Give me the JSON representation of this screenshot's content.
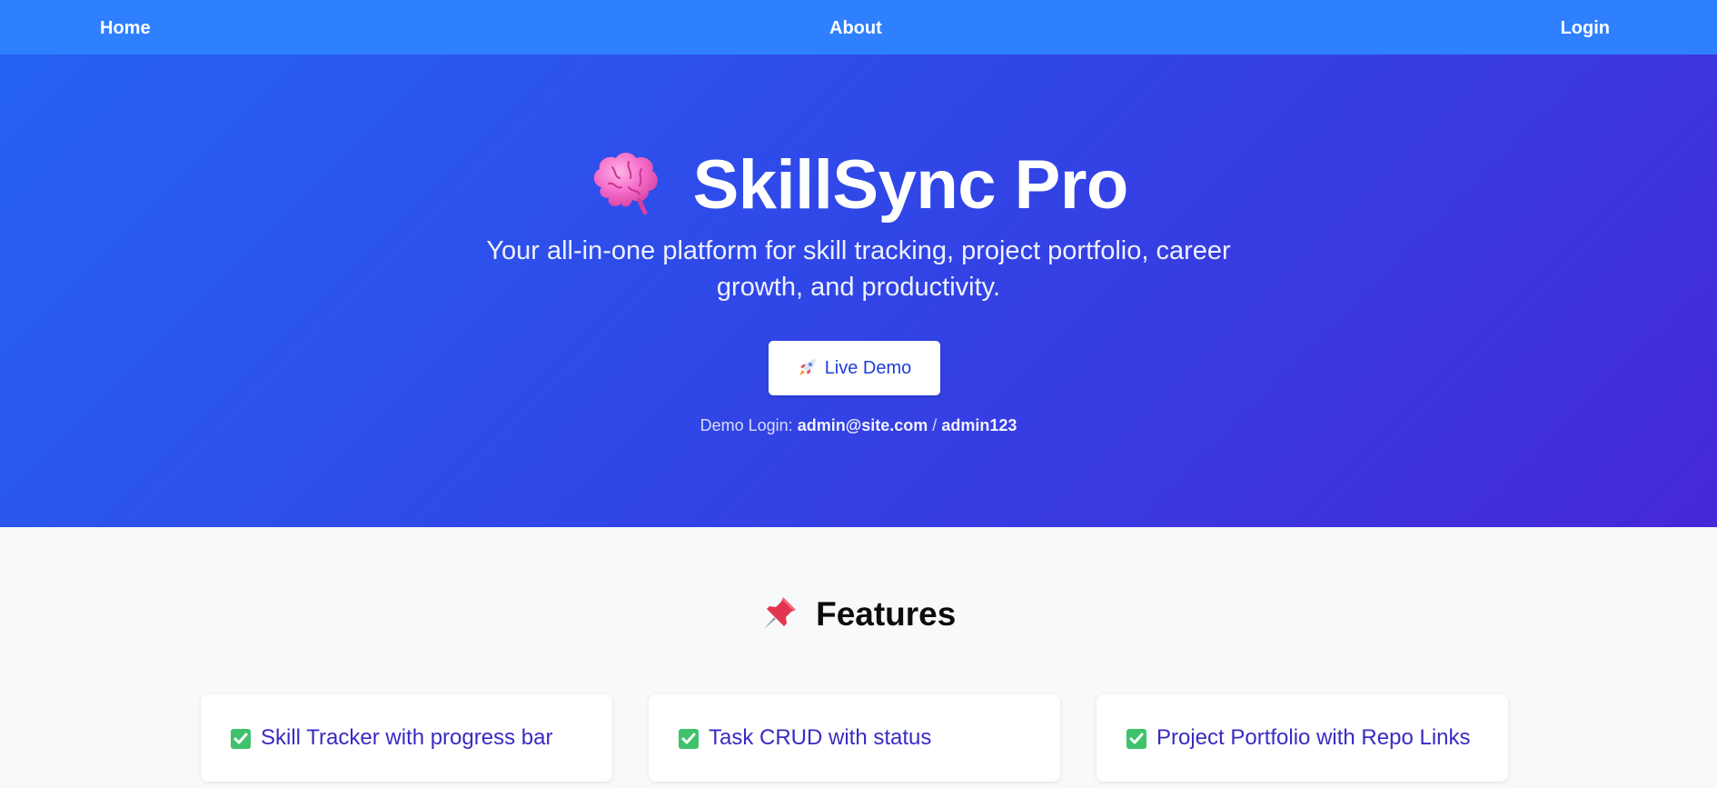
{
  "nav": {
    "home": "Home",
    "about": "About",
    "login": "Login"
  },
  "hero": {
    "icon": "brain-icon",
    "title": "SkillSync Pro",
    "subtitle": "Your all-in-one platform for skill tracking, project portfolio, career growth, and productivity.",
    "demo_button": {
      "icon": "rocket-icon",
      "label": "Live Demo"
    },
    "demo_login": {
      "prefix": "Demo Login:",
      "email": "admin@site.com",
      "separator": "/",
      "password": "admin123"
    }
  },
  "features": {
    "icon": "pushpin-icon",
    "title": "Features",
    "items": [
      {
        "icon": "check-icon",
        "label": "Skill Tracker with progress bar"
      },
      {
        "icon": "check-icon",
        "label": "Task CRUD with status"
      },
      {
        "icon": "check-icon",
        "label": "Project Portfolio with Repo Links"
      }
    ]
  },
  "colors": {
    "nav_bg": "#2f80ff",
    "hero_gradient_start": "#2563f3",
    "hero_gradient_end": "#4528d8",
    "button_text": "#1d3fd8",
    "feature_text": "#3a2bc2",
    "check_green": "#3fc26b",
    "page_bg": "#f8f9fb"
  }
}
